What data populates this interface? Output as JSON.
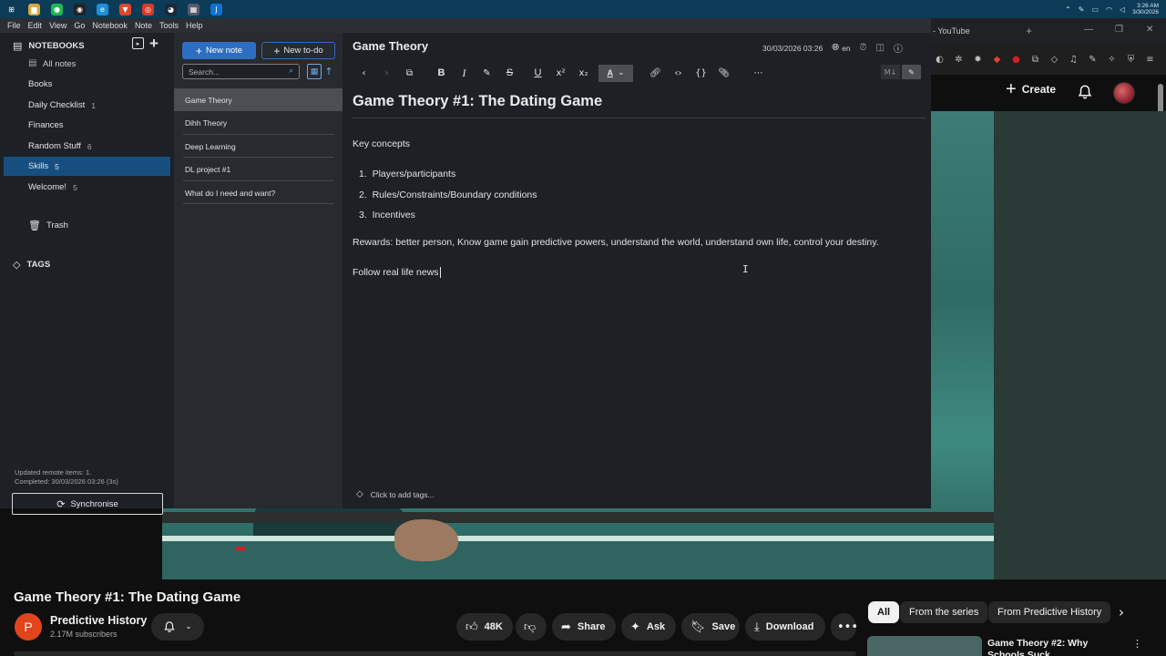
{
  "taskbar": {
    "apps": [
      {
        "icon": "windows-icon",
        "glyph": "⊞",
        "color": "#0b3b56"
      },
      {
        "icon": "file-explorer-icon",
        "glyph": "▆",
        "color": "#d9a83a"
      },
      {
        "icon": "spotify-icon",
        "glyph": "●",
        "color": "#1db954"
      },
      {
        "icon": "app-dark-icon",
        "glyph": "◉",
        "color": "#222222"
      },
      {
        "icon": "edge-icon",
        "glyph": "e",
        "color": "#1f8fd8"
      },
      {
        "icon": "brave-icon",
        "glyph": "▼",
        "color": "#e0452a"
      },
      {
        "icon": "chrome-icon",
        "glyph": "◎",
        "color": "#d83a2a"
      },
      {
        "icon": "steam-icon",
        "glyph": "◕",
        "color": "#1b2838"
      },
      {
        "icon": "gallery-icon",
        "glyph": "▦",
        "color": "#5a5a6a"
      },
      {
        "icon": "joplin-icon",
        "glyph": "J",
        "color": "#1071d3"
      }
    ],
    "clock_time": "3:26 AM",
    "clock_date": "3/30/2026"
  },
  "youtube": {
    "tab_title": "- YouTube",
    "create_label": "Create",
    "video_title": "Game Theory #1: The Dating Game",
    "channel_initial": "P",
    "channel_name": "Predictive History",
    "subscribers": "2.17M subscribers",
    "likes": "48K",
    "share_label": "Share",
    "ask_label": "Ask",
    "save_label": "Save",
    "download_label": "Download",
    "chips": [
      "All",
      "From the series",
      "From Predictive History"
    ],
    "rec_title": "Game Theory #2:  Why Schools Suck"
  },
  "joplin": {
    "menu": [
      "File",
      "Edit",
      "View",
      "Go",
      "Notebook",
      "Note",
      "Tools",
      "Help"
    ],
    "sidebar": {
      "notebooks_header": "NOTEBOOKS",
      "all_notes": "All notes",
      "notebooks": [
        {
          "label": "Books",
          "count": ""
        },
        {
          "label": "Daily Checklist",
          "count": "1"
        },
        {
          "label": "Finances",
          "count": ""
        },
        {
          "label": "Random Stuff",
          "count": "6"
        },
        {
          "label": "Skills",
          "count": "5"
        },
        {
          "label": "Welcome!",
          "count": "5"
        }
      ],
      "trash": "Trash",
      "tags_header": "TAGS",
      "sync_status_1": "Updated remote items: 1.",
      "sync_status_2": "Completed: 30/03/2026 03:26 (3s)",
      "sync_button": "Synchronise"
    },
    "notelist": {
      "new_note": "New note",
      "new_todo": "New to-do",
      "search_placeholder": "Search...",
      "notes": [
        "Game Theory",
        "Dihh Theory",
        "Deep Learning",
        "DL project #1",
        "What do I need and want?"
      ]
    },
    "editor": {
      "title": "Game Theory",
      "datetime": "30/03/2026 03:26",
      "language": "en",
      "heading": "Game Theory #1: The Dating Game",
      "para_concepts": "Key concepts",
      "list": [
        "Players/participants",
        "Rules/Constraints/Boundary conditions",
        "Incentives"
      ],
      "para_rewards": "Rewards: better person, Know game gain predictive powers, understand the world, understand own life, control your destiny.",
      "para_follow": "Follow real life news",
      "tags_hint": "Click to add tags..."
    }
  }
}
